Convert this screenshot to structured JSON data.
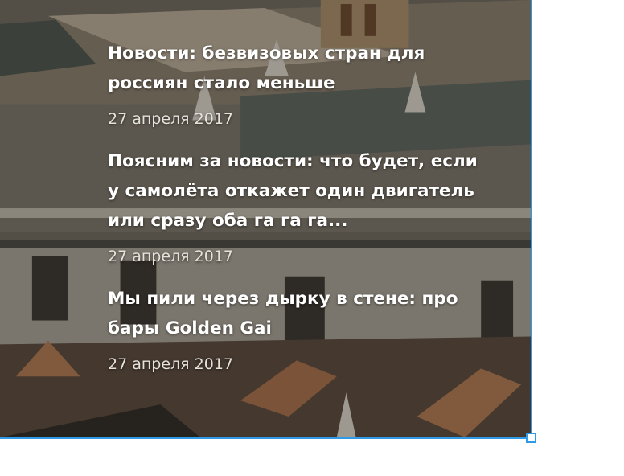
{
  "accent_color": "#2f9ae6",
  "background_image": "photo of an old palace building with roofs and turrets",
  "news": [
    {
      "title": "Новости: безвизовых стран для россиян стало меньше",
      "date": "27 апреля 2017"
    },
    {
      "title": "Поясним за новости: что будет, если у самолёта откажет один двигатель или сразу оба га га га...",
      "date": "27 апреля 2017"
    },
    {
      "title": "Мы пили через дырку в стене: про бары Golden Gai",
      "date": "27 апреля 2017"
    }
  ]
}
